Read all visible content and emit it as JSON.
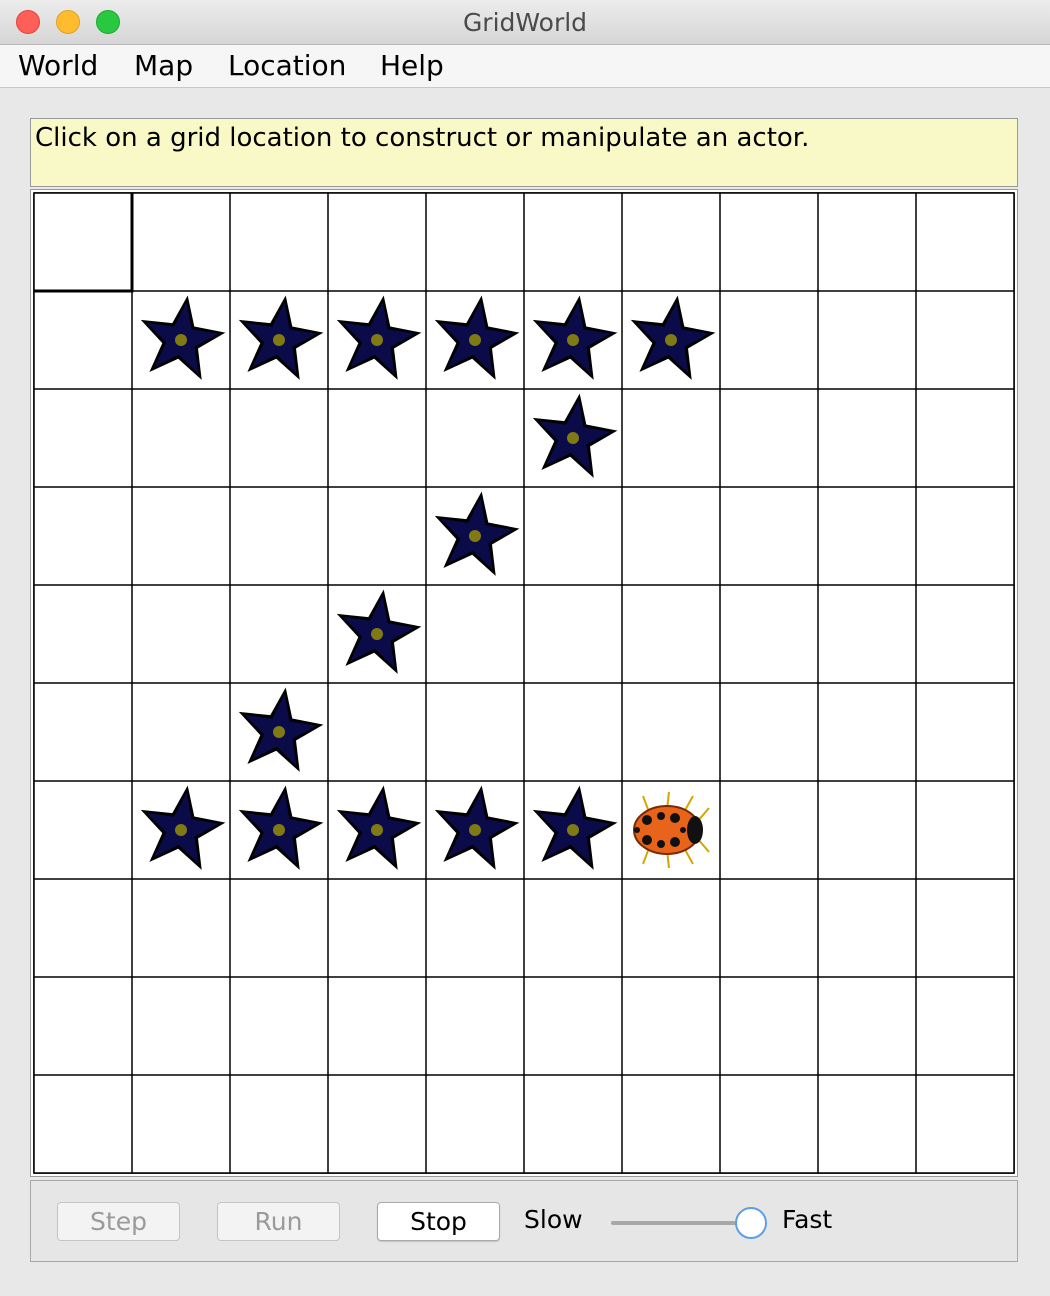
{
  "window": {
    "title": "GridWorld"
  },
  "menu": [
    "World",
    "Map",
    "Location",
    "Help"
  ],
  "message": "Click on a grid location to construct or manipulate an actor.",
  "grid": {
    "rows": 10,
    "cols": 10,
    "selected": [
      0,
      0
    ],
    "flowers": [
      [
        1,
        1
      ],
      [
        1,
        2
      ],
      [
        1,
        3
      ],
      [
        1,
        4
      ],
      [
        1,
        5
      ],
      [
        1,
        6
      ],
      [
        2,
        5
      ],
      [
        3,
        4
      ],
      [
        4,
        3
      ],
      [
        5,
        2
      ],
      [
        6,
        1
      ],
      [
        6,
        2
      ],
      [
        6,
        3
      ],
      [
        6,
        4
      ],
      [
        6,
        5
      ]
    ],
    "bugs": [
      {
        "pos": [
          6,
          6
        ],
        "direction": "east"
      }
    ],
    "flower_color": "#0b0b4a",
    "bug_color": "#e8641b"
  },
  "controls": {
    "step_label": "Step",
    "run_label": "Run",
    "stop_label": "Stop",
    "slow_label": "Slow",
    "fast_label": "Fast",
    "speed_level": 1.0
  }
}
